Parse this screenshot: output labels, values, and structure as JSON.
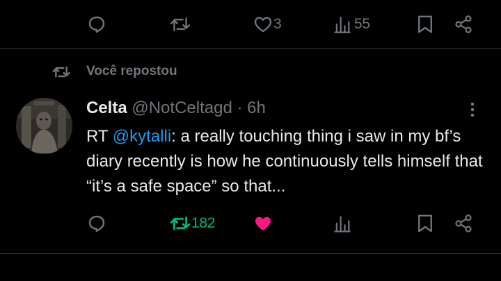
{
  "top_actions": {
    "reply_count": "",
    "repost_count": "",
    "like_count": "3",
    "views_count": "55"
  },
  "repost_banner": {
    "label": "Você repostou"
  },
  "tweet": {
    "author_name": "Celta",
    "author_handle": "@NotCeltagd",
    "separator": "·",
    "time": "6h",
    "text_prefix": "RT ",
    "mention": "@kytalli",
    "text_body": ": a really touching thing i saw in my bf’s diary recently is how he continuously tells himself that “it’s a safe space” so that...",
    "actions": {
      "reply_count": "",
      "repost_count": "182",
      "like_count": "",
      "views_count": ""
    }
  },
  "colors": {
    "background": "#000000",
    "text": "#e7e9ea",
    "muted": "#71767b",
    "mention": "#1d9bf0",
    "repost_active": "#00ba7c",
    "like_active": "#f91880",
    "divider": "#2f3336"
  },
  "icons": {
    "reply": "reply-icon",
    "repost": "repost-icon",
    "like": "heart-icon",
    "views": "views-icon",
    "bookmark": "bookmark-icon",
    "share": "share-icon",
    "more": "more-icon"
  }
}
